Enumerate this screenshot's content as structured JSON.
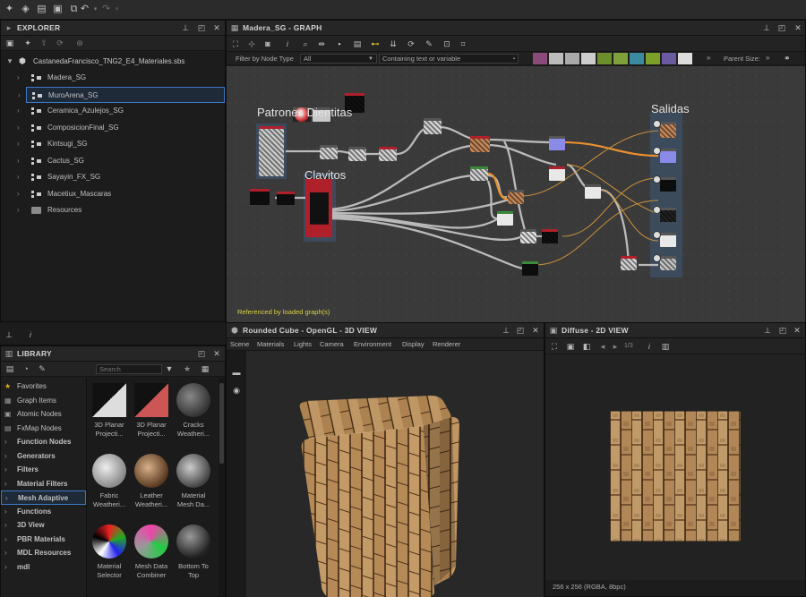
{
  "explorer": {
    "title": "EXPLORER",
    "package": "CastanedaFrancisco_TNG2_E4_Materiales.sbs",
    "items": [
      {
        "label": "Madera_SG"
      },
      {
        "label": "MuroArena_SG"
      },
      {
        "label": "Ceramica_Azulejos_SG"
      },
      {
        "label": "ComposicionFinal_SG"
      },
      {
        "label": "Kintsugi_SG"
      },
      {
        "label": "Cactus_SG"
      },
      {
        "label": "Sayayin_FX_SG"
      },
      {
        "label": "Macetiux_Mascaras"
      },
      {
        "label": "Resources"
      }
    ]
  },
  "graph": {
    "title": "Madera_SG - GRAPH",
    "filter_label": "Filter by Node Type",
    "filter_value": "All",
    "search_placeholder": "Containing text or variable",
    "parent_size_label": "Parent Size:",
    "frames": {
      "patron": "Patrones Dientitas",
      "clavitos": "Clavitos",
      "salidas": "Salidas"
    },
    "status": "Referenced by loaded graph(s)"
  },
  "library": {
    "title": "LIBRARY",
    "search_placeholder": "Search",
    "categories": [
      {
        "label": "Favorites",
        "icon": "star-icon"
      },
      {
        "label": "Graph Items",
        "icon": "graph-items-icon"
      },
      {
        "label": "Atomic Nodes",
        "icon": "atomic-icon"
      },
      {
        "label": "FxMap Nodes",
        "icon": "fxmap-icon"
      },
      {
        "label": "Function Nodes",
        "icon": "folder-icon"
      },
      {
        "label": "Generators",
        "icon": "folder-icon"
      },
      {
        "label": "Filters",
        "icon": "folder-icon"
      },
      {
        "label": "Material Filters",
        "icon": "folder-icon"
      },
      {
        "label": "Mesh Adaptive",
        "icon": "folder-icon"
      },
      {
        "label": "Functions",
        "icon": "folder-icon"
      },
      {
        "label": "3D View",
        "icon": "folder-icon"
      },
      {
        "label": "PBR Materials",
        "icon": "folder-icon"
      },
      {
        "label": "MDL Resources",
        "icon": "folder-icon"
      },
      {
        "label": "mdl",
        "icon": "folder-icon"
      }
    ],
    "items": [
      {
        "l1": "3D Planar",
        "l2": "Projecti..."
      },
      {
        "l1": "3D Planar",
        "l2": "Projecti..."
      },
      {
        "l1": "Cracks",
        "l2": "Weatheri..."
      },
      {
        "l1": "Fabric",
        "l2": "Weatheri..."
      },
      {
        "l1": "Leather",
        "l2": "Weatheri..."
      },
      {
        "l1": "Material",
        "l2": "Mesh Da..."
      },
      {
        "l1": "Material",
        "l2": "Selector"
      },
      {
        "l1": "Mesh Data",
        "l2": "Combiner"
      },
      {
        "l1": "Bottom To",
        "l2": "Top"
      }
    ]
  },
  "view3d": {
    "title": "Rounded Cube - OpenGL - 3D VIEW",
    "menu": [
      "Scene",
      "Materials",
      "Lights",
      "Camera",
      "Environment",
      "Display",
      "Renderer"
    ]
  },
  "view2d": {
    "title": "Diffuse - 2D VIEW",
    "zoom_label": "1/3",
    "status": "256 x 256 (RGBA, 8bpc)"
  },
  "colors": {
    "wood_light": "#c39a66",
    "wood_dark": "#6b4a2a",
    "accent_blue": "#5ea0ff",
    "node_red": "#b0202a",
    "wire_orange": "#e8902e"
  }
}
